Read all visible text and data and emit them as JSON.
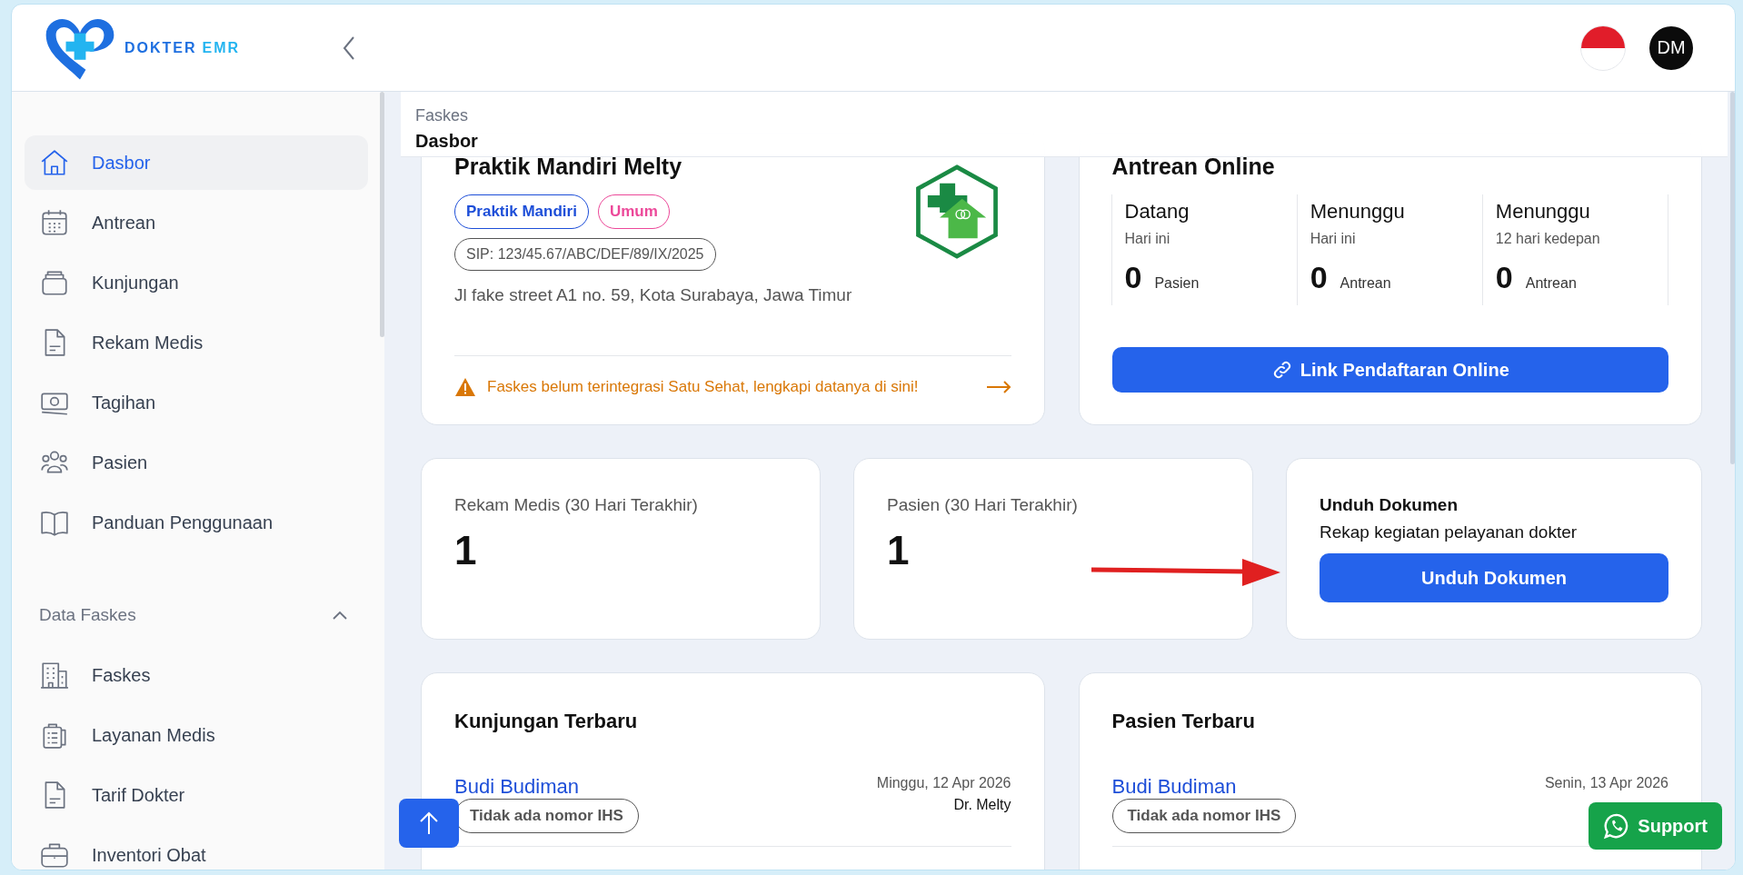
{
  "header": {
    "logo_words": [
      "DOKTER",
      "EMR"
    ],
    "avatar": "DM"
  },
  "sidebar": {
    "items": [
      {
        "label": "Dasbor",
        "selected": true
      },
      {
        "label": "Antrean",
        "selected": false
      },
      {
        "label": "Kunjungan",
        "selected": false
      },
      {
        "label": "Rekam Medis",
        "selected": false
      },
      {
        "label": "Tagihan",
        "selected": false
      },
      {
        "label": "Pasien",
        "selected": false
      },
      {
        "label": "Panduan Penggunaan",
        "selected": false
      }
    ],
    "sections": [
      {
        "title": "Data Faskes",
        "expanded": true,
        "items": [
          {
            "label": "Faskes",
            "selected": false
          },
          {
            "label": "Layanan Medis",
            "selected": false
          },
          {
            "label": "Tarif Dokter",
            "selected": false
          },
          {
            "label": "Inventori Obat",
            "selected": false
          }
        ]
      }
    ]
  },
  "breadcrumb": {
    "parent": "Faskes",
    "current": "Dasbor"
  },
  "facility_card": {
    "title": "Praktik Mandiri Melty",
    "tags": [
      {
        "label": "Praktik Mandiri",
        "color": "#1d4ed8"
      },
      {
        "label": "Umum",
        "color": "#ec4899"
      }
    ],
    "sip": "SIP: 123/45.67/ABC/DEF/89/IX/2025",
    "address": "Jl fake street A1 no. 59, Kota Surabaya, Jawa Timur",
    "warning": "Faskes belum terintegrasi Satu Sehat, lengkapi datanya di sini!"
  },
  "queue_card": {
    "title": "Antrean Online",
    "stats": [
      {
        "label": "Datang",
        "sub": "Hari ini",
        "value": "0",
        "unit": "Pasien"
      },
      {
        "label": "Menunggu",
        "sub": "Hari ini",
        "value": "0",
        "unit": "Antrean"
      },
      {
        "label": "Menunggu",
        "sub": "12 hari kedepan",
        "value": "0",
        "unit": "Antrean"
      }
    ],
    "button": "Link Pendaftaran Online"
  },
  "stat_cards": [
    {
      "label": "Rekam Medis (30 Hari Terakhir)",
      "value": "1"
    },
    {
      "label": "Pasien (30 Hari Terakhir)",
      "value": "1"
    }
  ],
  "download_card": {
    "title": "Unduh Dokumen",
    "subtitle": "Rekap kegiatan pelayanan dokter",
    "button": "Unduh Dokumen"
  },
  "recent_visits": {
    "title": "Kunjungan Terbaru",
    "rows": [
      {
        "name": "Budi Budiman",
        "badge": "Tidak ada nomor IHS",
        "date": "Minggu, 12 Apr 2026",
        "doctor": "Dr. Melty"
      }
    ]
  },
  "recent_patients": {
    "title": "Pasien Terbaru",
    "rows": [
      {
        "name": "Budi Budiman",
        "badge": "Tidak ada nomor IHS",
        "date": "Senin, 13 Apr 2026"
      }
    ]
  },
  "support_button": "Support"
}
